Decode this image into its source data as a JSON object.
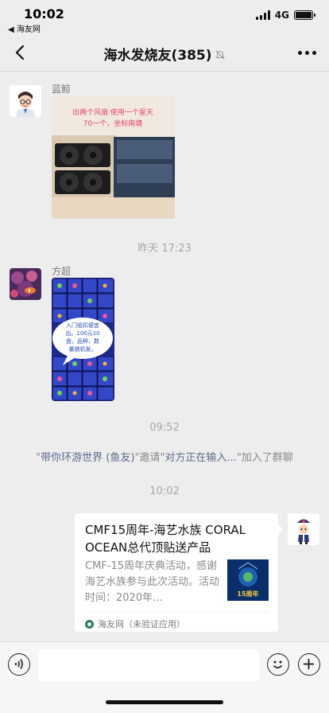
{
  "status_bar": {
    "time": "10:02",
    "back_app": "◀ 海友网",
    "network": "4G",
    "battery_level": 1.0
  },
  "header": {
    "title": "海水发烧友(385)",
    "icons": [
      "back-arrow-icon",
      "muted-bell-icon",
      "more-icon"
    ]
  },
  "messages": [
    {
      "type": "image",
      "sender": "蓝鲸",
      "image_caption_line1": "出两个风扇 使用一个星天",
      "image_caption_line2": "70一个，坐标南塘"
    },
    {
      "type": "timestamp",
      "text": "昨天 17:23"
    },
    {
      "type": "image",
      "sender": "方超",
      "bubble_line1": "入门组扣便宜",
      "bubble_line2": "出。100元10",
      "bubble_line3": "盘，品种，数",
      "bubble_line4": "量随机发。"
    },
    {
      "type": "timestamp",
      "text": "09:52"
    },
    {
      "type": "system",
      "q1": "\"",
      "name1": "带你环游世界 (鱼友)",
      "mid": "\"邀请\"",
      "name2": "对方正在输入...",
      "tail": "\"加入了群聊"
    },
    {
      "type": "timestamp",
      "text": "10:02"
    },
    {
      "type": "link_card",
      "title": "CMF15周年-海艺水族 CORAL OCEAN总代顶贴送产品",
      "description": "CMF-15周年庆典活动，感谢海艺水族参与此次活动。活动时间：2020年...",
      "thumb_text": "15周年",
      "source": "海友网（未验证应用）"
    }
  ],
  "input_bar": {
    "placeholder": "",
    "icons": [
      "voice-icon",
      "emoji-icon",
      "plus-icon"
    ]
  },
  "colors": {
    "background": "#ededed",
    "system_link": "#5b6b8f",
    "timestamp": "#a8a8a8"
  }
}
